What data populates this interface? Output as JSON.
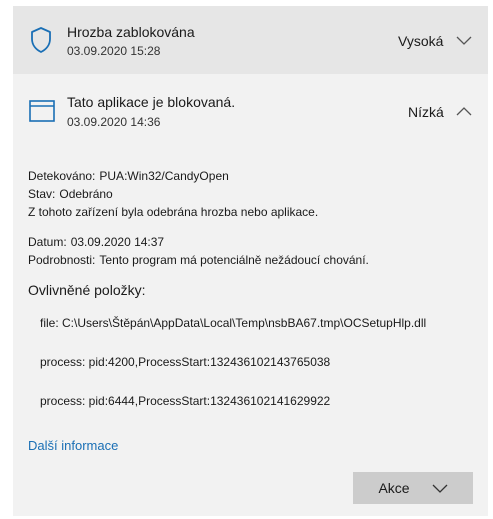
{
  "threat": {
    "title": "Hrozba zablokována",
    "date": "03.09.2020 15:28",
    "severity": "Vysoká"
  },
  "app_block": {
    "title": "Tato aplikace je blokovaná.",
    "date": "03.09.2020 14:36",
    "severity": "Nízká"
  },
  "details": {
    "detected_label": "Detekováno:",
    "detected_value": "PUA:Win32/CandyOpen",
    "status_label": "Stav:",
    "status_value": "Odebráno",
    "status_note": "Z tohoto zařízení byla odebrána hrozba nebo aplikace.",
    "date_label": "Datum:",
    "date_value": "03.09.2020 14:37",
    "info_label": "Podrobnosti:",
    "info_value": "Tento program má potenciálně nežádoucí chování."
  },
  "affected": {
    "title": "Ovlivněné položky:",
    "items": [
      "file: C:\\Users\\Štěpán\\AppData\\Local\\Temp\\nsbBA67.tmp\\OCSetupHlp.dll",
      "process: pid:4200,ProcessStart:132436102143765038",
      "process: pid:6444,ProcessStart:132436102141629922"
    ]
  },
  "more_info_link": "Další informace",
  "actions_label": "Akce",
  "colors": {
    "accent": "#1a6fb5",
    "header_bg": "#e6e6e6",
    "panel_bg": "#f2f2f2",
    "button_bg": "#cccccc"
  },
  "icons": {
    "threat": "shield-icon",
    "app": "app-window-icon"
  }
}
